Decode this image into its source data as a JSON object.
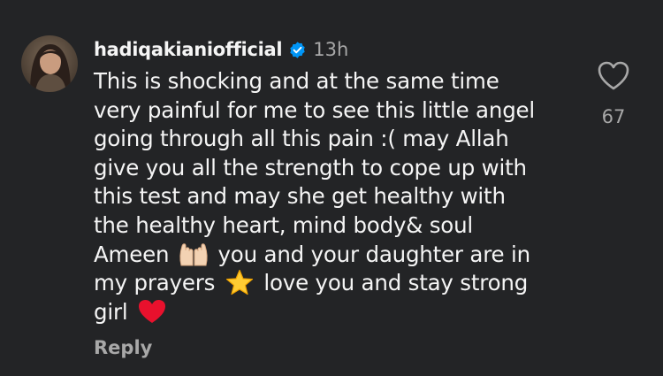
{
  "comment": {
    "username": "hadiqakianiofficial",
    "verified": true,
    "timestamp": "13h",
    "text_lines": {
      "l1": "This is shocking and at the same time",
      "l2": "very painful for me to see this little angel",
      "l3": "going through all this pain :( may Allah",
      "l4": "give you all the strength to cope up with",
      "l5": "this test and may she get healthy with",
      "l6": "the healthy heart, mind body& soul",
      "l7a": "Ameen",
      "l7b": "you and your daughter are in",
      "l8a": "my prayers",
      "l8b": "love you and stay strong",
      "l9": "girl"
    },
    "emojis": [
      "palms-up-together",
      "star",
      "red-heart"
    ],
    "reply_label": "Reply",
    "like_count": "67"
  },
  "colors": {
    "background": "#232426",
    "primary_text": "#f5f5f5",
    "secondary_text": "#a8a8a8",
    "verified_blue": "#0095f6",
    "heart_red": "#e8112d",
    "star_yellow": "#ffcc33"
  },
  "icons": {
    "verified": "verified-badge-icon",
    "like": "heart-outline-icon"
  }
}
